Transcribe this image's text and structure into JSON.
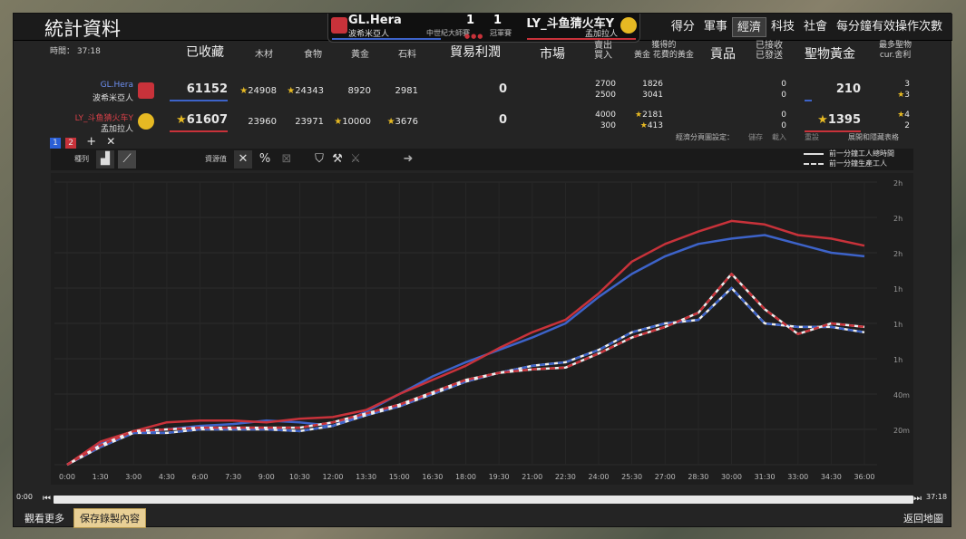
{
  "window": {
    "title": "統計資料",
    "time_label": "時間：",
    "time_value": "37:18"
  },
  "match": {
    "p1_name": "GL.Hera",
    "p1_civ": "波希米亞人",
    "p2_name": "LY_斗鱼猜火车Y",
    "p2_civ": "孟加拉人",
    "score1": "1",
    "score2": "1",
    "age_p1": "中世紀大師賽",
    "age_p2": "冠軍賽"
  },
  "tabs": [
    {
      "label": "得分",
      "active": false
    },
    {
      "label": "軍事",
      "active": false
    },
    {
      "label": "經濟",
      "active": true
    },
    {
      "label": "科技",
      "active": false
    },
    {
      "label": "社會",
      "active": false
    },
    {
      "label": "每分鐘有效操作次數",
      "active": false
    }
  ],
  "columns": {
    "collected": "已收藏",
    "wood": "木材",
    "food": "食物",
    "gold": "黃金",
    "stone": "石料",
    "trade": "貿易利潤",
    "market": "市場",
    "sell_buy": [
      "賣出",
      "買入"
    ],
    "gold_earned": [
      "獲得的",
      "黃金 花費的黃金"
    ],
    "tribute": "貢品",
    "received_sent": [
      "已接收",
      "已發送"
    ],
    "relic_gold": "聖物黃金",
    "max_relics": [
      "最多聖物",
      "cur.舍利"
    ]
  },
  "players": [
    {
      "name": "GL.Hera",
      "civ": "波希米亞人",
      "color": "#3d63c9",
      "collected": "61152",
      "wood": "24908",
      "food": "24343",
      "gold": "8920",
      "stone": "2981",
      "trade": "0",
      "sold": "2700",
      "bought": "2500",
      "gold_got": "1826",
      "gold_spent": "3041",
      "received": "0",
      "sent": "0",
      "relic_gold": "210",
      "max_relics": "3",
      "cur_relics": "3"
    },
    {
      "name": "LY_斗鱼猜火车Y",
      "civ": "孟加拉人",
      "color": "#c8323a",
      "collected": "61607",
      "wood": "23960",
      "food": "23971",
      "gold": "10000",
      "stone": "3676",
      "trade": "0",
      "sold": "4000",
      "bought": "300",
      "gold_got": "2181",
      "gold_spent": "413",
      "received": "0",
      "sent": "0",
      "relic_gold": "1395",
      "max_relics": "4",
      "cur_relics": "2"
    }
  ],
  "toolbar": {
    "team_tabs": [
      "1",
      "2"
    ],
    "settings_label": "經濟分頁圖設定：",
    "save_label": "儲存",
    "load_label": "載入",
    "reset_label": "重設",
    "expand_label": "展開和隱藏表格",
    "sequence_label": "種列",
    "resource_label": "資源值"
  },
  "legend": {
    "solid": "前一分鐘工人總時間",
    "dashed": "前一分鐘生產工人"
  },
  "chart_data": {
    "type": "line",
    "x": [
      "0:00",
      "1:30",
      "3:00",
      "4:30",
      "6:00",
      "7:30",
      "9:00",
      "10:30",
      "12:00",
      "13:30",
      "15:00",
      "16:30",
      "18:00",
      "19:30",
      "21:00",
      "22:30",
      "24:00",
      "25:30",
      "27:00",
      "28:30",
      "30:00",
      "31:30",
      "33:00",
      "34:30",
      "36:00"
    ],
    "y_tick_labels": [
      "2h",
      "2h",
      "2h",
      "1h",
      "1h",
      "1h",
      "40m",
      "20m"
    ],
    "series": [
      {
        "color": "#3d63c9",
        "style": "solid",
        "values": [
          0,
          12,
          18,
          20,
          22,
          23,
          25,
          24,
          22,
          30,
          40,
          50,
          58,
          65,
          72,
          80,
          95,
          108,
          118,
          125,
          128,
          130,
          125,
          120,
          118
        ]
      },
      {
        "color": "#c8323a",
        "style": "solid",
        "values": [
          0,
          13,
          19,
          24,
          25,
          25,
          24,
          26,
          27,
          31,
          40,
          48,
          56,
          66,
          75,
          82,
          97,
          115,
          125,
          132,
          138,
          136,
          130,
          128,
          124
        ]
      },
      {
        "color": "#3d63c9",
        "style": "dashed",
        "values": [
          0,
          10,
          18,
          18,
          20,
          20,
          20,
          19,
          22,
          28,
          33,
          40,
          47,
          52,
          56,
          58,
          65,
          75,
          80,
          82,
          100,
          80,
          78,
          78,
          75
        ]
      },
      {
        "color": "#c8323a",
        "style": "dashed",
        "values": [
          0,
          11,
          19,
          20,
          21,
          21,
          21,
          21,
          24,
          29,
          34,
          41,
          48,
          52,
          54,
          55,
          63,
          72,
          78,
          86,
          108,
          88,
          74,
          80,
          78
        ]
      }
    ],
    "ylim": [
      0,
      160
    ]
  },
  "timeline": {
    "start": "0:00",
    "end": "37:18"
  },
  "bottom": {
    "more_label": "觀看更多",
    "save_record_label": "保存錄製內容",
    "back_label": "返回地圖"
  }
}
